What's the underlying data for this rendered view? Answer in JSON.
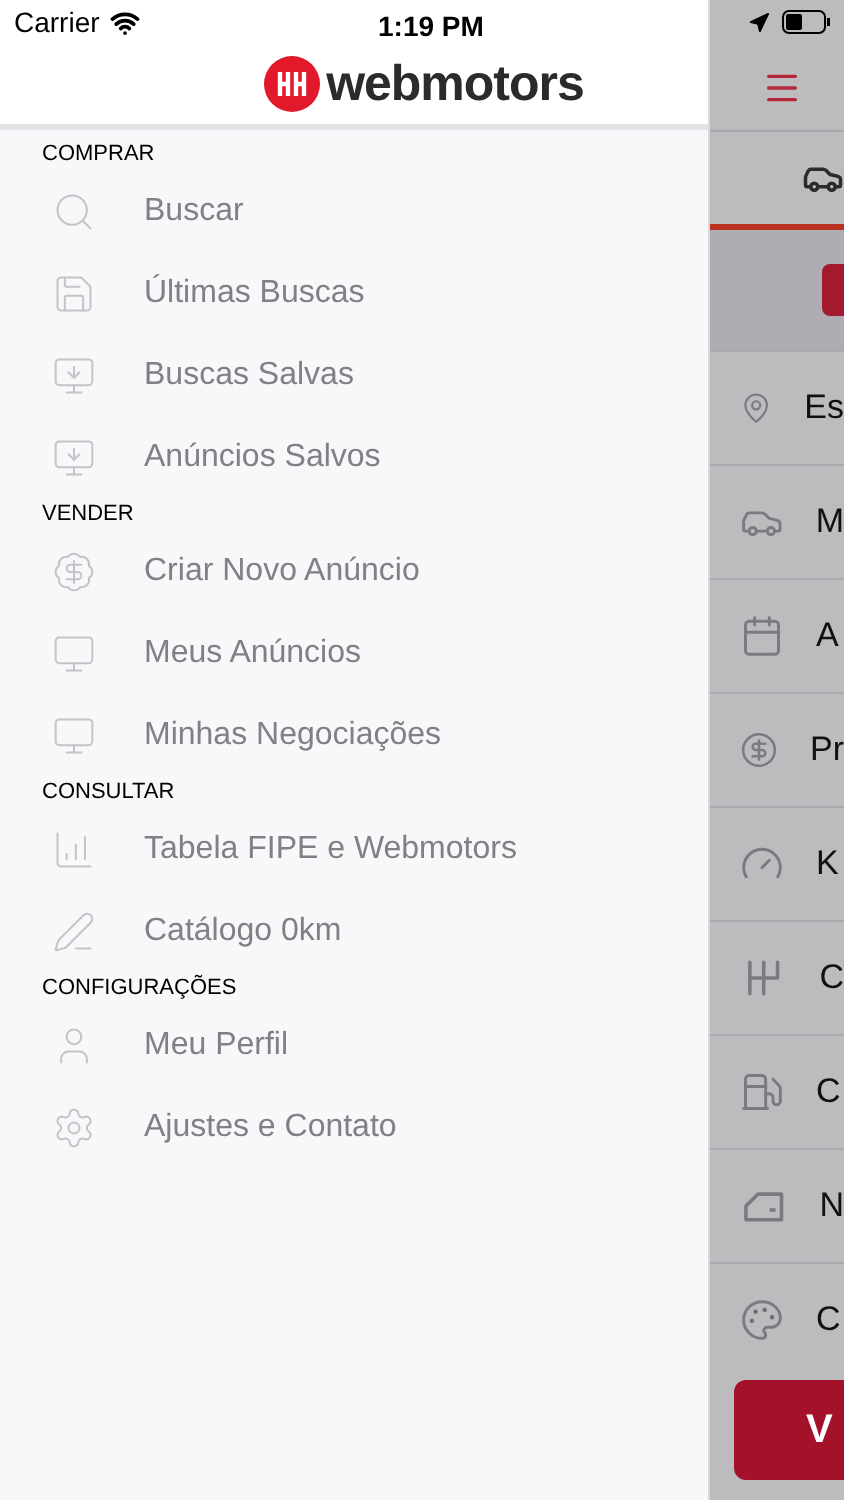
{
  "status_bar": {
    "carrier": "Carrier",
    "time": "1:19 PM"
  },
  "header": {
    "brand": "webmotors"
  },
  "menu": [
    {
      "title": "COMPRAR",
      "items": [
        {
          "kind": "search",
          "label": "Buscar"
        },
        {
          "kind": "history",
          "label": "Últimas Buscas"
        },
        {
          "kind": "saved",
          "label": "Buscas Salvas"
        },
        {
          "kind": "saved",
          "label": "Anúncios Salvos"
        }
      ]
    },
    {
      "title": "VENDER",
      "items": [
        {
          "kind": "money",
          "label": "Criar Novo Anúncio"
        },
        {
          "kind": "listing",
          "label": "Meus Anúncios"
        },
        {
          "kind": "listing",
          "label": "Minhas Negociações"
        }
      ]
    },
    {
      "title": "CONSULTAR",
      "items": [
        {
          "kind": "chart",
          "label": "Tabela FIPE e Webmotors"
        },
        {
          "kind": "catalog",
          "label": "Catálogo 0km"
        }
      ]
    },
    {
      "title": "CONFIGURAÇÕES",
      "items": [
        {
          "kind": "user",
          "label": "Meu Perfil"
        },
        {
          "kind": "settings",
          "label": "Ajustes e Contato"
        }
      ]
    }
  ],
  "background_filters": [
    {
      "kind": "location",
      "label": "Es"
    },
    {
      "kind": "car",
      "label": "M"
    },
    {
      "kind": "calendar",
      "label": "A"
    },
    {
      "kind": "price",
      "label": "Pr"
    },
    {
      "kind": "gauge",
      "label": "K"
    },
    {
      "kind": "gearbox",
      "label": "C"
    },
    {
      "kind": "fuel",
      "label": "C"
    },
    {
      "kind": "door",
      "label": "N"
    },
    {
      "kind": "palette",
      "label": "C"
    }
  ],
  "background_button": {
    "label": "V"
  }
}
